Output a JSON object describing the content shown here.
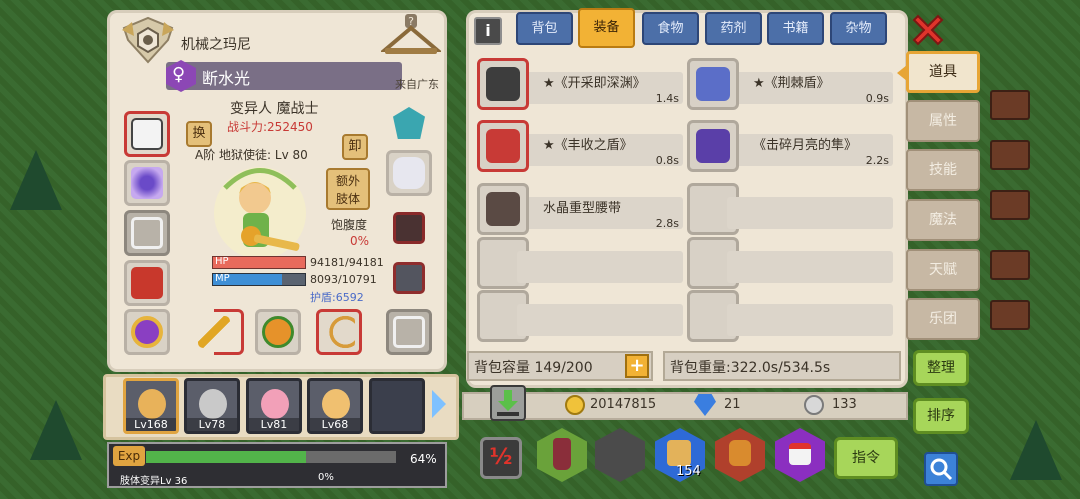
{
  "title": "机械之玛尼",
  "char": {
    "gender_icon": "female-symbol",
    "name": "断水光",
    "origin": "来自广东",
    "class_label": "变异人 魔战士",
    "power": "战斗力:252450",
    "rank": "A阶 地狱使徒: Lv 80",
    "swap": "换",
    "unload": "卸",
    "extra_limb": "额外\n肢体",
    "satiety_label": "饱腹度",
    "satiety_value": "0%",
    "hp_label": "HP",
    "hp_value": "94181/94181",
    "hp_frac": 1.0,
    "mp_label": "MP",
    "mp_value": "8093/10791",
    "mp_frac": 0.75,
    "shield": "护盾:6592"
  },
  "party": [
    {
      "level": "Lv168",
      "active": true
    },
    {
      "level": "Lv78",
      "active": false
    },
    {
      "level": "Lv81",
      "active": false
    },
    {
      "level": "Lv68",
      "active": false
    }
  ],
  "exp": {
    "label": "Exp",
    "percent_text": "64%",
    "frac": 0.64,
    "limb_label": "肢体变异Lv 36",
    "limb_percent": "0%"
  },
  "tabs": [
    {
      "label": "背包"
    },
    {
      "label": "装备"
    },
    {
      "label": "食物"
    },
    {
      "label": "药剂"
    },
    {
      "label": "书籍"
    },
    {
      "label": "杂物"
    }
  ],
  "items": [
    {
      "name": "★《开采即深渊》",
      "weight": "1.4s",
      "icon": "pickaxe-icon"
    },
    {
      "name": "★《荆棘盾》",
      "weight": "0.9s",
      "icon": "thorn-shield-icon"
    },
    {
      "name": "★《丰收之盾》",
      "weight": "0.8s",
      "icon": "harvest-shield-icon"
    },
    {
      "name": "《击碎月亮的隼》",
      "weight": "2.2s",
      "icon": "armor-icon"
    },
    {
      "name": "水晶重型腰带",
      "weight": "2.8s",
      "icon": "belt-icon"
    }
  ],
  "capacity": "背包容量 149/200",
  "weight_text": "背包重量:322.0s/534.5s",
  "currency": {
    "gold": "20147815",
    "gem": "21",
    "silver": "133"
  },
  "side_tabs": [
    {
      "label": "道具"
    },
    {
      "label": "属性"
    },
    {
      "label": "技能"
    },
    {
      "label": "魔法"
    },
    {
      "label": "天赋"
    },
    {
      "label": "乐团"
    }
  ],
  "buttons": {
    "organize": "整理",
    "sort": "排序",
    "command": "指令"
  },
  "quick_badge": "154",
  "colors": {
    "accent": "#f2b235",
    "tab_blue": "#4c6fa8",
    "close_red": "#e0332b",
    "green_btn": "#a7d65a"
  }
}
